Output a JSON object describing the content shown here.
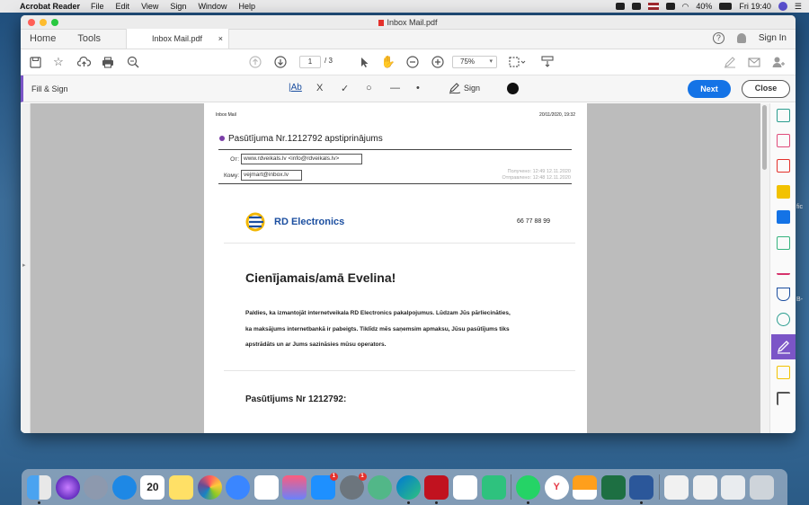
{
  "menubar": {
    "app_name": "Acrobat Reader",
    "menus": [
      "File",
      "Edit",
      "View",
      "Sign",
      "Window",
      "Help"
    ],
    "battery": "40%",
    "clock": "Fri 19:40"
  },
  "window": {
    "title": "Inbox Mail.pdf",
    "tabs": {
      "home": "Home",
      "tools": "Tools",
      "doc": "Inbox Mail.pdf",
      "close_tab": "×"
    },
    "help_label": "?",
    "sign_in": "Sign In"
  },
  "toolbar": {
    "page_current": "1",
    "page_total": "/ 3",
    "zoom": "75%"
  },
  "fill_sign": {
    "title": "Fill & Sign",
    "text_tool": "|Ab",
    "cross_tool": "X",
    "check_tool": "✓",
    "ellipse_tool": "○",
    "line_tool": "—",
    "dot_tool": "•",
    "sign_label": "Sign",
    "next": "Next",
    "close": "Close"
  },
  "document": {
    "header_left": "Inbox Mail",
    "header_right": "20/11/2020, 19:32",
    "subject": "Pasūtījuma Nr.1212792 apstiprinājums",
    "from_label": "От:",
    "from_value": "www.rdveikals.lv <info@rdveikals.lv>",
    "to_label": "Кому:",
    "to_value": "vejmart@inbox.lv",
    "received": "Получено: 12:49 12.11.2020",
    "sent": "Отправлено: 12:48 12.11.2020",
    "brand": "RD Electronics",
    "phone": "66 77 88 99",
    "greeting": "Cienījamais/amā Evelina!",
    "para1": "Paldies, ka izmantojāt internetveikala RD Electronics pakalpojumus. Lūdzam Jūs pārliecināties,",
    "para2": "ka maksājums internetbankā ir pabeigts. Tiklīdz mēs saņemsim apmaksu, Jūsu pasūtījums tiks",
    "para3": "apstrādāts un ar Jums sazināsies mūsu operators.",
    "order_heading": "Pasūtījums Nr 1212792:"
  },
  "desktop_edge": {
    "fic": "fic",
    "b": "B-"
  },
  "dock": {
    "calendar_day": "20",
    "badge_appstore": "1",
    "badge_prefs": "1"
  },
  "colors": {
    "accent_purple": "#7b55c7",
    "next_blue": "#1473e6",
    "brand_blue": "#1c4fa0"
  }
}
